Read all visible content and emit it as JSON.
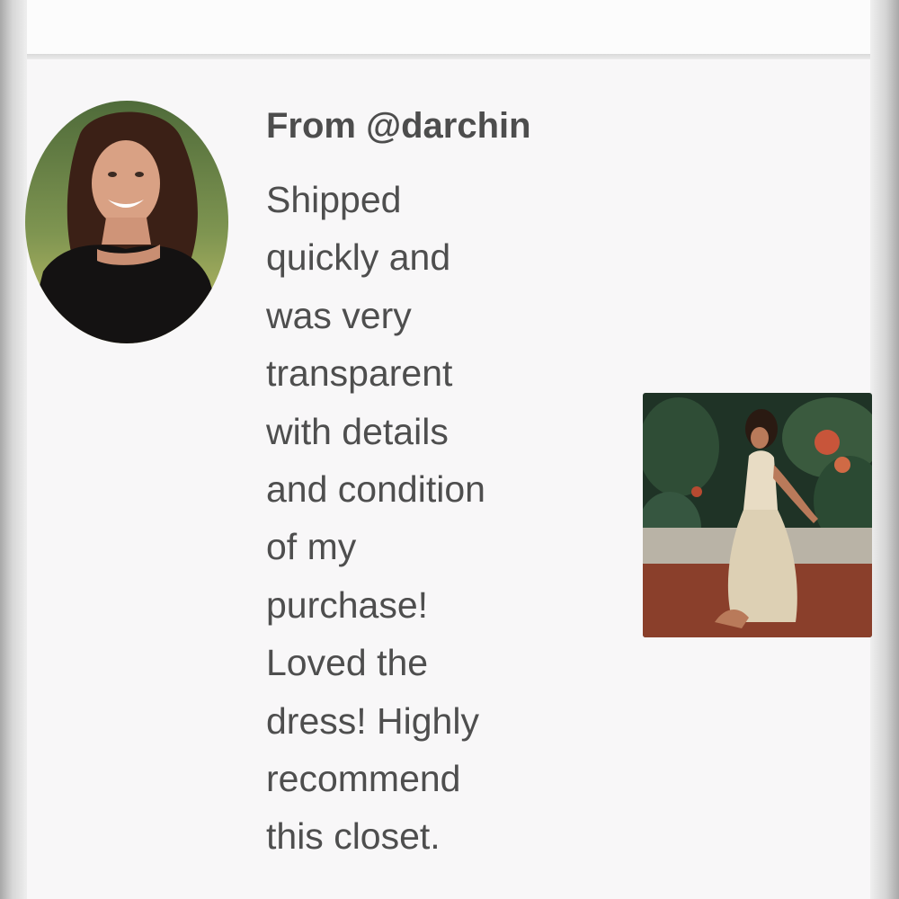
{
  "review": {
    "from_label": "From @darchin",
    "text_lines": [
      "Shipped",
      "quickly and",
      "was very",
      "transparent",
      "with details",
      "and condition",
      "of my",
      "purchase!",
      "Loved the",
      "dress! Highly",
      "recommend",
      "this closet."
    ]
  },
  "images": {
    "avatar": "reviewer-profile-photo",
    "attachment": "dress-photo-thumbnail"
  },
  "colors": {
    "text": "#4e4e4e",
    "card_background": "#f8f7f8"
  }
}
